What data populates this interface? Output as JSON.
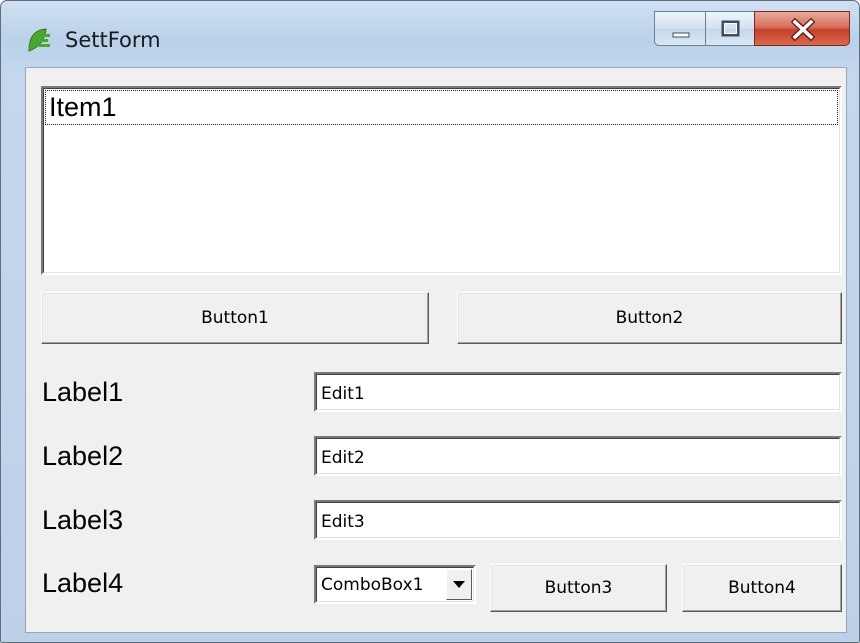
{
  "window": {
    "title": "SettForm"
  },
  "listbox": {
    "items": [
      "Item1"
    ]
  },
  "buttons": {
    "button1": "Button1",
    "button2": "Button2",
    "button3": "Button3",
    "button4": "Button4"
  },
  "labels": [
    "Label1",
    "Label2",
    "Label3",
    "Label4"
  ],
  "edits": [
    "Edit1",
    "Edit2",
    "Edit3"
  ],
  "combobox": {
    "value": "ComboBox1"
  },
  "icons": {
    "app": "app-leaf-icon",
    "minimize": "minimize-icon",
    "maximize": "maximize-icon",
    "close": "close-icon",
    "dropdown": "dropdown-arrow-icon"
  },
  "colors": {
    "title_bar": "#b9d1ea",
    "close_button": "#c4412a",
    "app_icon": "#4aa832",
    "client_bg": "#f0f0f0"
  }
}
